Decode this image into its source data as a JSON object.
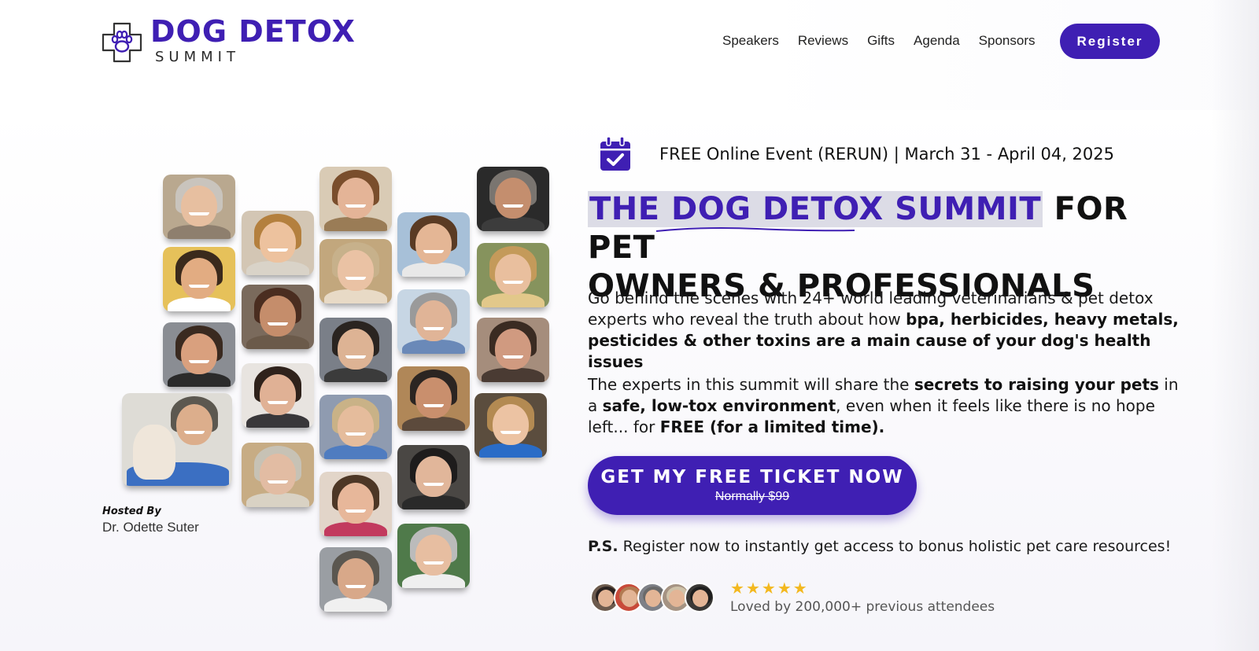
{
  "brand": {
    "title": "DOG DETOX",
    "subtitle": "SUMMIT",
    "accent_color": "#3f1fb3"
  },
  "nav": {
    "items": [
      "Speakers",
      "Reviews",
      "Gifts",
      "Agenda",
      "Sponsors"
    ],
    "register_label": "Register"
  },
  "hero": {
    "event_line": "FREE Online Event (RERUN) | March 31 - April 04, 2025",
    "headline_highlight": "THE DOG DETOX SUMMIT",
    "headline_rest_line1": " FOR PET",
    "headline_line2": "OWNERS & PROFESSIONALS",
    "para1_plain": "Go behind the scenes with 24+ world leading veterinarians & pet detox experts who reveal the truth about how ",
    "para1_bold": "bpa, herbicides, heavy metals, pesticides & other toxins are a main cause of your dog's health issues",
    "para2_a": "The experts in this summit will share the ",
    "para2_b": "secrets to raising your pets",
    "para2_c": " in a ",
    "para2_d": "safe, low-tox environment",
    "para2_e": ", even when it feels like there is no hope left... for ",
    "para2_f": "FREE (for a limited time).",
    "cta_label": "GET MY FREE TICKET NOW",
    "cta_sub": "Normally $99",
    "ps_label": "P.S.",
    "ps_text": " Register now to instantly get access to bonus holistic pet care resources!",
    "rating_stars": 5,
    "loved_text": "Loved by 200,000+ previous attendees"
  },
  "host": {
    "label": "Hosted By",
    "name": "Dr. Odette Suter"
  },
  "speaker_photos": [
    {
      "name": "speaker-photo-1",
      "hair": "#c9c4bd",
      "skin": "#e7bfa0",
      "shirt": "#8e7f6e",
      "bg": "#b9a88f"
    },
    {
      "name": "speaker-photo-2",
      "hair": "#3b2a1c",
      "skin": "#e2ac82",
      "shirt": "#ffffff",
      "bg": "#e6c15a"
    },
    {
      "name": "speaker-photo-3",
      "hair": "#3a2a20",
      "skin": "#d9a07e",
      "shirt": "#2b2b2b",
      "bg": "#8a8d93"
    },
    {
      "name": "speaker-photo-4",
      "hair": "#5c5850",
      "skin": "#dcae8c",
      "shirt": "#3b6fc2",
      "bg": "#dedcd6"
    },
    {
      "name": "speaker-photo-5",
      "hair": "#b4803e",
      "skin": "#edc29e",
      "shirt": "#d9d3c8",
      "bg": "#d3c6b4"
    },
    {
      "name": "speaker-photo-6",
      "hair": "#4a2d20",
      "skin": "#c58d6b",
      "shirt": "#6b5a4a",
      "bg": "#7a6a5c"
    },
    {
      "name": "speaker-photo-7",
      "hair": "#2f221b",
      "skin": "#e0b195",
      "shirt": "#39373a",
      "bg": "#e8e4e0"
    },
    {
      "name": "speaker-photo-8",
      "hair": "#c7c2b5",
      "skin": "#e2bca3",
      "shirt": "#d9d2c4",
      "bg": "#c7ac84"
    },
    {
      "name": "speaker-photo-9",
      "hair": "#7a4e2c",
      "skin": "#e4b497",
      "shirt": "#9a7c56",
      "bg": "#d9cbb5"
    },
    {
      "name": "speaker-photo-10",
      "hair": "#c7b18b",
      "skin": "#eac2a4",
      "shirt": "#e8dac6",
      "bg": "#c2a77d"
    },
    {
      "name": "speaker-photo-11",
      "hair": "#2a2420",
      "skin": "#ddb394",
      "shirt": "#3b3b3b",
      "bg": "#7a7f88"
    },
    {
      "name": "speaker-photo-12",
      "hair": "#c9b287",
      "skin": "#e5bc9c",
      "shirt": "#4f7cc0",
      "bg": "#8f9bb0"
    },
    {
      "name": "speaker-photo-13",
      "hair": "#4d3726",
      "skin": "#e7b79a",
      "shirt": "#c23a5e",
      "bg": "#e2d5c9"
    },
    {
      "name": "speaker-photo-14",
      "hair": "#5b5750",
      "skin": "#d8a889",
      "shirt": "#f0f0f0",
      "bg": "#9a9ea3"
    },
    {
      "name": "speaker-photo-15",
      "hair": "#5a3b24",
      "skin": "#e4b695",
      "shirt": "#e8e8e8",
      "bg": "#a7c0d8"
    },
    {
      "name": "speaker-photo-16",
      "hair": "#9a9a9a",
      "skin": "#e0b497",
      "shirt": "#6a89b8",
      "bg": "#c7d6e4"
    },
    {
      "name": "speaker-photo-17",
      "hair": "#2b2522",
      "skin": "#c98f6d",
      "shirt": "#5c4a3c",
      "bg": "#b08758"
    },
    {
      "name": "speaker-photo-18",
      "hair": "#1e1c1c",
      "skin": "#e1b69a",
      "shirt": "#2a2a2a",
      "bg": "#4a4744"
    },
    {
      "name": "speaker-photo-19",
      "hair": "#bbbbbb",
      "skin": "#e7bea1",
      "shirt": "#efefef",
      "bg": "#4f7a4a"
    },
    {
      "name": "speaker-photo-20",
      "hair": "#7a7570",
      "skin": "#c48e6e",
      "shirt": "#3c3c3c",
      "bg": "#2a2a2a"
    },
    {
      "name": "speaker-photo-21",
      "hair": "#c49a5a",
      "skin": "#e9bf9e",
      "shirt": "#e2c88a",
      "bg": "#86935d"
    },
    {
      "name": "speaker-photo-22",
      "hair": "#3a2b22",
      "skin": "#d09a80",
      "shirt": "#4a3b33",
      "bg": "#a58d7c"
    },
    {
      "name": "speaker-photo-23",
      "hair": "#b38a52",
      "skin": "#ecc3a3",
      "shirt": "#2a6cc7",
      "bg": "#5b4d3e"
    }
  ],
  "attendee_avatars": [
    {
      "name": "attendee-avatar-1",
      "hair": "#2a2220",
      "bg": "#6c5a4d"
    },
    {
      "name": "attendee-avatar-2",
      "hair": "#b27b52",
      "bg": "#c84a3a"
    },
    {
      "name": "attendee-avatar-3",
      "hair": "#6a6a6a",
      "bg": "#7e8087"
    },
    {
      "name": "attendee-avatar-4",
      "hair": "#cfc2a9",
      "bg": "#a59383"
    },
    {
      "name": "attendee-avatar-5",
      "hair": "#1f1f1f",
      "bg": "#3a3836"
    }
  ]
}
